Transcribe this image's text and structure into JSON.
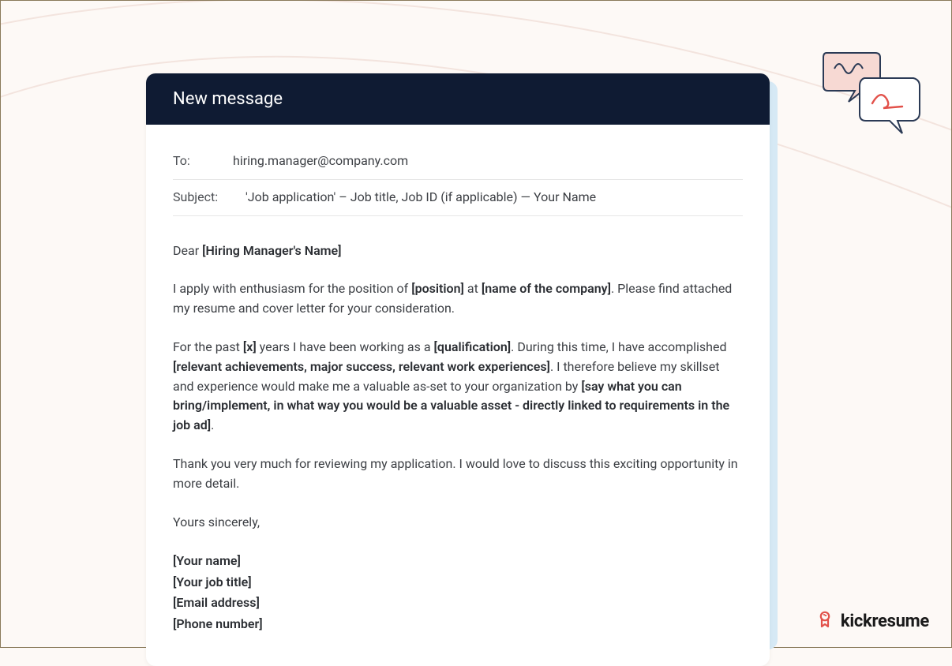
{
  "header": {
    "title": "New message"
  },
  "fields": {
    "to_label": "To:",
    "to_value": "hiring.manager@company.com",
    "subject_label": "Subject:",
    "subject_value": "'Job application' – Job title, Job ID (if applicable) — Your Name"
  },
  "body": {
    "greeting_prefix": "Dear ",
    "greeting_bold": "[Hiring Manager's Name]",
    "p1_a": "I apply with enthusiasm for the position of ",
    "p1_b": "[position]",
    "p1_c": " at ",
    "p1_d": "[name of the company]",
    "p1_e": ". Please find attached my resume and cover letter for your consideration.",
    "p2_a": "For the past ",
    "p2_b": "[x]",
    "p2_c": " years I have been working as a ",
    "p2_d": "[qualification]",
    "p2_e": ". During this time, I have accomplished ",
    "p2_f": "[relevant achievements, major success, relevant work experiences]",
    "p2_g": ". I therefore believe my skillset and experience would make me a valuable as-set to your organization by ",
    "p2_h": "[say what you can bring/implement, in what way you would be a valuable asset - directly linked to requirements in the job ad]",
    "p2_i": ".",
    "p3": "Thank you very much for reviewing my application. I would love to discuss this exciting opportunity in more detail.",
    "signoff": "Yours sincerely,",
    "sig1": "[Your name]",
    "sig2": "[Your job title]",
    "sig3": "[Email address]",
    "sig4": "[Phone number]"
  },
  "brand": {
    "name": "kickresume"
  }
}
